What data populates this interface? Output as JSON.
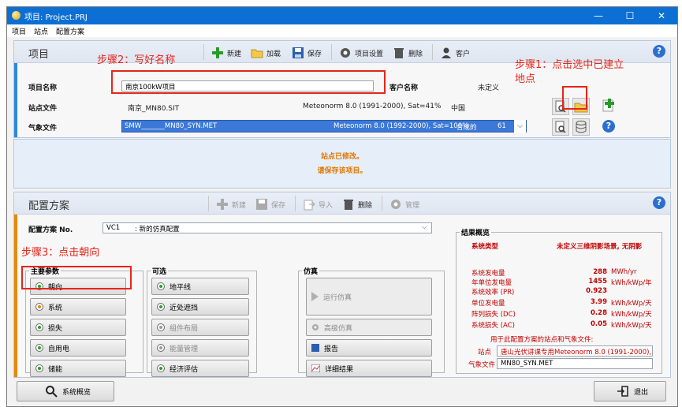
{
  "window": {
    "title": "项目: Project.PRJ",
    "minimize": "—",
    "maximize": "☐",
    "close": "✕"
  },
  "menu": [
    "项目",
    "站点",
    "配置方案"
  ],
  "project": {
    "section_title": "项目",
    "toolbar": {
      "new": "新建",
      "load": "加载",
      "save": "保存",
      "settings": "项目设置",
      "delete": "删除",
      "client": "客户"
    },
    "name_label": "项目名称",
    "name_value": "南京100kW项目",
    "client_label": "客户名称",
    "client_value": "未定义",
    "site_label": "站点文件",
    "site_file": "南京_MN80.SIT",
    "site_source": "Meteonorm 8.0 (1991-2000), Sat=41%",
    "site_country": "中国",
    "meteo_label": "气象文件",
    "meteo_file": "SMW_______MN80_SYN.MET",
    "meteo_source": "Meteonorm 8.0 (1992-2000), Sat=100%",
    "meteo_type": "合成的",
    "meteo_num": "61"
  },
  "annotations": {
    "step1_line1": "步骤1：点击选中已建立",
    "step1_line2": "地点",
    "step2": "步骤2：写好名称",
    "step3": "步骤3：点击朝向"
  },
  "message": {
    "line1": "站点已修改。",
    "line2": "请保存该项目。"
  },
  "variant": {
    "section_title": "配置方案",
    "toolbar": {
      "new": "新建",
      "save": "保存",
      "import": "导入",
      "delete": "删除",
      "manage": "管理"
    },
    "no_label": "配置方案 No.",
    "no_value": "VC1",
    "description": ": 新的仿真配置",
    "main_params_title": "主要参数",
    "main_params": [
      "朝向",
      "系统",
      "损失",
      "自用电",
      "储能"
    ],
    "optional_title": "可选",
    "optional": [
      "地平线",
      "近处遮挡",
      "组件布局",
      "能量管理",
      "经济评估"
    ],
    "sim_title": "仿真",
    "sim_buttons": [
      "运行仿真",
      "高级仿真",
      "报告",
      "详细结果"
    ]
  },
  "results": {
    "title": "结果概览",
    "system_type_label": "系统类型",
    "system_type_value": "未定义三维阴影场景, 无阴影",
    "rows": [
      {
        "label": "系统发电量",
        "value": "288",
        "unit": "MWh/yr"
      },
      {
        "label": "年单位发电量",
        "value": "1455",
        "unit": "kWh/kWp/年"
      },
      {
        "label": "系统效率 (PR)",
        "value": "0.923",
        "unit": ""
      },
      {
        "label": "单位发电量",
        "value": "3.99",
        "unit": "kWh/kWp/天"
      },
      {
        "label": "阵列损失 (DC)",
        "value": "0.28",
        "unit": "kWh/kWp/天"
      },
      {
        "label": "系统损失 (AC)",
        "value": "0.05",
        "unit": "kWh/kWp/天"
      }
    ],
    "files_caption": "用于此配置方案的站点和气象文件:",
    "site_label": "站点",
    "site_value": "唐山光伏讲课专用Meteonorm 8.0 (1991-2000), Sat",
    "meteo_label": "气象文件",
    "meteo_value": "MN80_SYN.MET"
  },
  "footer": {
    "overview": "系统概览",
    "exit": "退出"
  },
  "colors": {
    "titlebar": "#0b6fd4",
    "annotation": "#e8251a",
    "message": "#e07800",
    "results": "#c00000"
  }
}
